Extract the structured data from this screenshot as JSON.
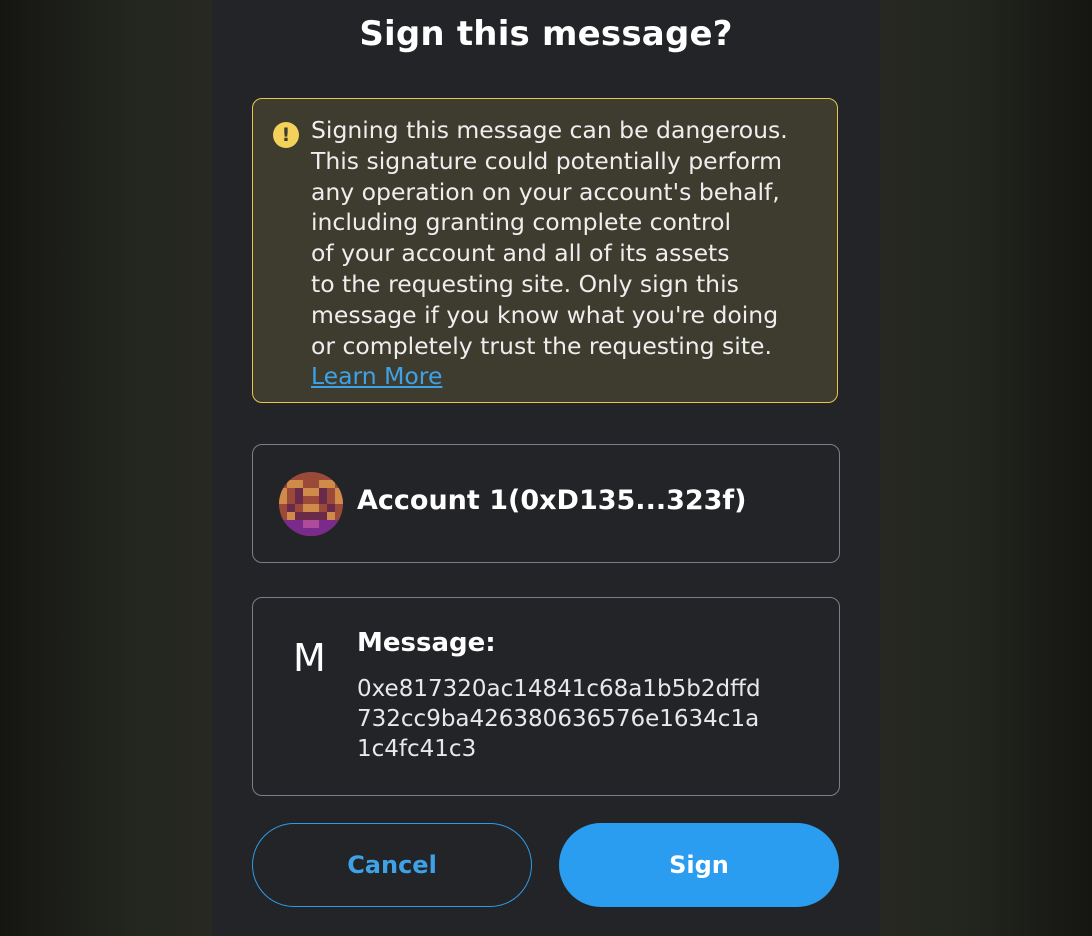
{
  "dialog": {
    "title": "Sign this message?"
  },
  "warning": {
    "icon": "exclamation-icon",
    "lines": [
      "Signing this message can be dangerous.",
      "This signature could potentially perform",
      "any operation on your account's behalf,",
      "including granting complete control",
      "of your account and all of its assets",
      "to the requesting site. Only sign this",
      "message if you know what you're doing",
      "or completely trust the requesting site."
    ],
    "link_label": "Learn More"
  },
  "account": {
    "avatar": "pixel-avatar",
    "name": "Account 1(0xD135...323f)"
  },
  "message": {
    "icon_letter": "M",
    "label": "Message:",
    "value_lines": [
      "0xe817320ac14841c68a1b5b2dffd",
      "732cc9ba426380636576e1634c1a",
      "1c4fc41c3"
    ]
  },
  "buttons": {
    "cancel_label": "Cancel",
    "sign_label": "Sign"
  },
  "colors": {
    "accent": "#2b9df0",
    "warning_border": "#e9c64a",
    "warning_bg": "#3e3c2f",
    "panel_bg": "#232427"
  }
}
